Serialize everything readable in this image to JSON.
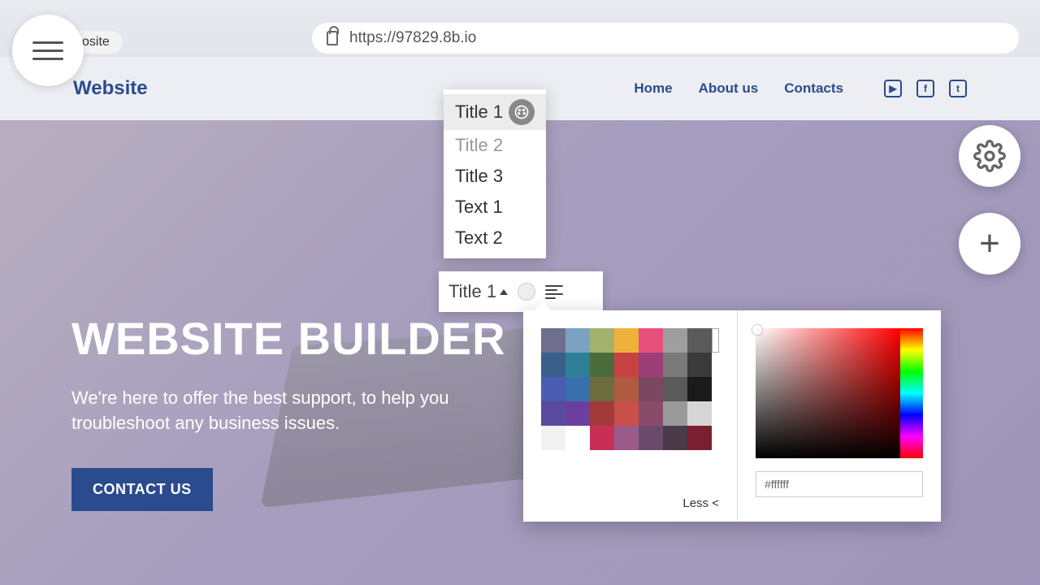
{
  "browser": {
    "tab_label": "osite",
    "url": "https://97829.8b.io"
  },
  "nav": {
    "brand": "Website",
    "links": [
      "Home",
      "About us",
      "Contacts"
    ]
  },
  "hero": {
    "title": "WEBSITE BUILDER",
    "subtitle": "We're here to offer the best support, to help you troubleshoot any business issues.",
    "button": "CONTACT US"
  },
  "style_menu": {
    "items": [
      {
        "label": "Title 1",
        "active": true
      },
      {
        "label": "Title 2",
        "muted": true
      },
      {
        "label": "Title 3"
      },
      {
        "label": "Text 1"
      },
      {
        "label": "Text 2"
      }
    ]
  },
  "format_bar": {
    "current_style": "Title 1"
  },
  "color_picker": {
    "less_label": "Less <",
    "hex_value": "#ffffff",
    "swatches_row1": [
      "#6e6e8e",
      "#7ba2c1",
      "#a3b36e",
      "#f0b13a",
      "#e84f7a",
      "#9e9e9e",
      "#5a5a5a"
    ],
    "swatches_row2": [
      "#3a5f8a",
      "#2c7f94",
      "#4a6b3a",
      "#c94242",
      "#9c3f78",
      "#7a7a7a",
      "#3a3a3a"
    ],
    "swatches_row3": [
      "#4a5db0",
      "#3a6fae",
      "#6c6c3f",
      "#b05a42",
      "#7a4660",
      "#5a5a5a",
      "#1a1a1a"
    ],
    "swatches_row4": [
      "#5a4a9e",
      "#6a3fa0",
      "#a33a3a",
      "#c94f4a",
      "#8a4a6a",
      "#9a9a9a",
      "#d6d6d6"
    ],
    "swatches_row5": [
      "#f2f2f2",
      "",
      "#c72f56",
      "#9a5a8a",
      "#6a4a6a",
      "#4a3a4a",
      "#7a1f2f"
    ],
    "white_swatch": "#ffffff"
  }
}
